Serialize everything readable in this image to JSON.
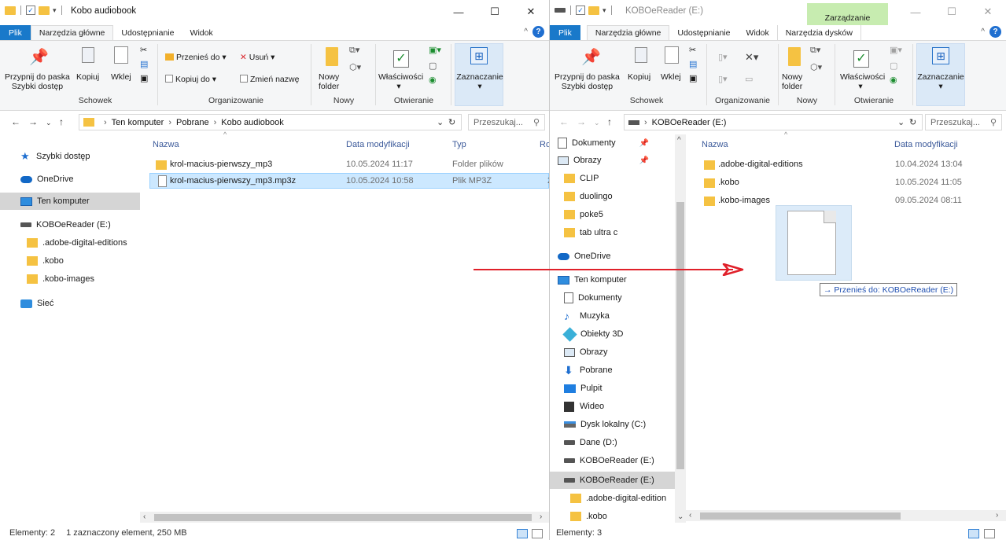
{
  "left": {
    "title": "Kobo audiobook",
    "tabs": [
      "Plik",
      "Narzędzia główne",
      "Udostępnianie",
      "Widok"
    ],
    "ribbon": {
      "pin": "Przypnij do paska\nSzybki dostęp",
      "copy": "Kopiuj",
      "paste": "Wklej",
      "move_to": "Przenieś do",
      "delete": "Usuń",
      "copy_to": "Kopiuj do",
      "rename": "Zmień nazwę",
      "new_folder": "Nowy\nfolder",
      "properties": "Właściwości",
      "select": "Zaznaczanie",
      "groups": [
        "Schowek",
        "Organizowanie",
        "Nowy",
        "Otwieranie"
      ]
    },
    "address": {
      "crumbs": [
        "Ten komputer",
        "Pobrane",
        "Kobo audiobook"
      ],
      "search_placeholder": "Przeszukaj..."
    },
    "nav": {
      "quick": "Szybki dostęp",
      "onedrive": "OneDrive",
      "pc": "Ten komputer",
      "drive": "KOBOeReader (E:)",
      "sub": [
        ".adobe-digital-editions",
        ".kobo",
        ".kobo-images"
      ],
      "network": "Sieć"
    },
    "columns": [
      "Nazwa",
      "Data modyfikacji",
      "Typ",
      "Ro"
    ],
    "files": [
      {
        "name": "krol-macius-pierwszy_mp3",
        "date": "10.05.2024 11:17",
        "type": "Folder plików",
        "kind": "folder"
      },
      {
        "name": "krol-macius-pierwszy_mp3.mp3z",
        "date": "10.05.2024 10:58",
        "type": "Plik MP3Z",
        "kind": "file",
        "size_partial": "2"
      }
    ],
    "status": {
      "count": "Elementy: 2",
      "selection": "1 zaznaczony element, 250 MB"
    }
  },
  "right": {
    "title": "KOBOeReader (E:)",
    "context_tab": "Zarządzanie",
    "tabs": [
      "Plik",
      "Narzędzia główne",
      "Udostępnianie",
      "Widok",
      "Narzędzia dysków"
    ],
    "ribbon": {
      "pin": "Przypnij do paska\nSzybki dostęp",
      "copy": "Kopiuj",
      "paste": "Wklej",
      "new_folder": "Nowy\nfolder",
      "properties": "Właściwości",
      "select": "Zaznaczanie",
      "groups": [
        "Schowek",
        "Organizowanie",
        "Nowy",
        "Otwieranie"
      ]
    },
    "address": {
      "crumb": "KOBOeReader (E:)",
      "search_placeholder": "Przeszukaj..."
    },
    "nav_items": [
      {
        "label": "Dokumenty",
        "icon": "documents-icon",
        "pinned": true
      },
      {
        "label": "Obrazy",
        "icon": "pictures-icon",
        "pinned": true
      },
      {
        "label": "CLIP",
        "icon": "folder-icon"
      },
      {
        "label": "duolingo",
        "icon": "folder-icon"
      },
      {
        "label": "poke5",
        "icon": "folder-icon"
      },
      {
        "label": "tab ultra c",
        "icon": "folder-icon"
      },
      {
        "label": "OneDrive",
        "icon": "onedrive-icon"
      },
      {
        "label": "Ten komputer",
        "icon": "computer-icon"
      },
      {
        "label": "Dokumenty",
        "icon": "documents-icon"
      },
      {
        "label": "Muzyka",
        "icon": "music-icon"
      },
      {
        "label": "Obiekty 3D",
        "icon": "3d-objects-icon"
      },
      {
        "label": "Obrazy",
        "icon": "pictures-icon"
      },
      {
        "label": "Pobrane",
        "icon": "downloads-icon"
      },
      {
        "label": "Pulpit",
        "icon": "desktop-icon"
      },
      {
        "label": "Wideo",
        "icon": "video-icon"
      },
      {
        "label": "Dysk lokalny (C:)",
        "icon": "local-disk-icon"
      },
      {
        "label": "Dane (D:)",
        "icon": "drive-icon"
      },
      {
        "label": "KOBOeReader (E:)",
        "icon": "drive-icon"
      },
      {
        "label": "KOBOeReader (E:)",
        "icon": "drive-icon",
        "selected": true
      },
      {
        "label": ".adobe-digital-edition",
        "icon": "folder-icon"
      },
      {
        "label": ".kobo",
        "icon": "folder-icon"
      }
    ],
    "columns": [
      "Nazwa",
      "Data modyfikacji"
    ],
    "files": [
      {
        "name": ".adobe-digital-editions",
        "date": "10.04.2024 13:04"
      },
      {
        "name": ".kobo",
        "date": "10.05.2024 11:05"
      },
      {
        "name": ".kobo-images",
        "date": "09.05.2024 08:11"
      }
    ],
    "status": {
      "count": "Elementy: 3"
    }
  },
  "drag": {
    "tooltip": "→ Przenieś do: KOBOeReader (E:)"
  },
  "colors": {
    "accent": "#1979ca",
    "selection": "#cce8ff",
    "arrow": "#e0202a",
    "context": "#c7ecb0"
  }
}
